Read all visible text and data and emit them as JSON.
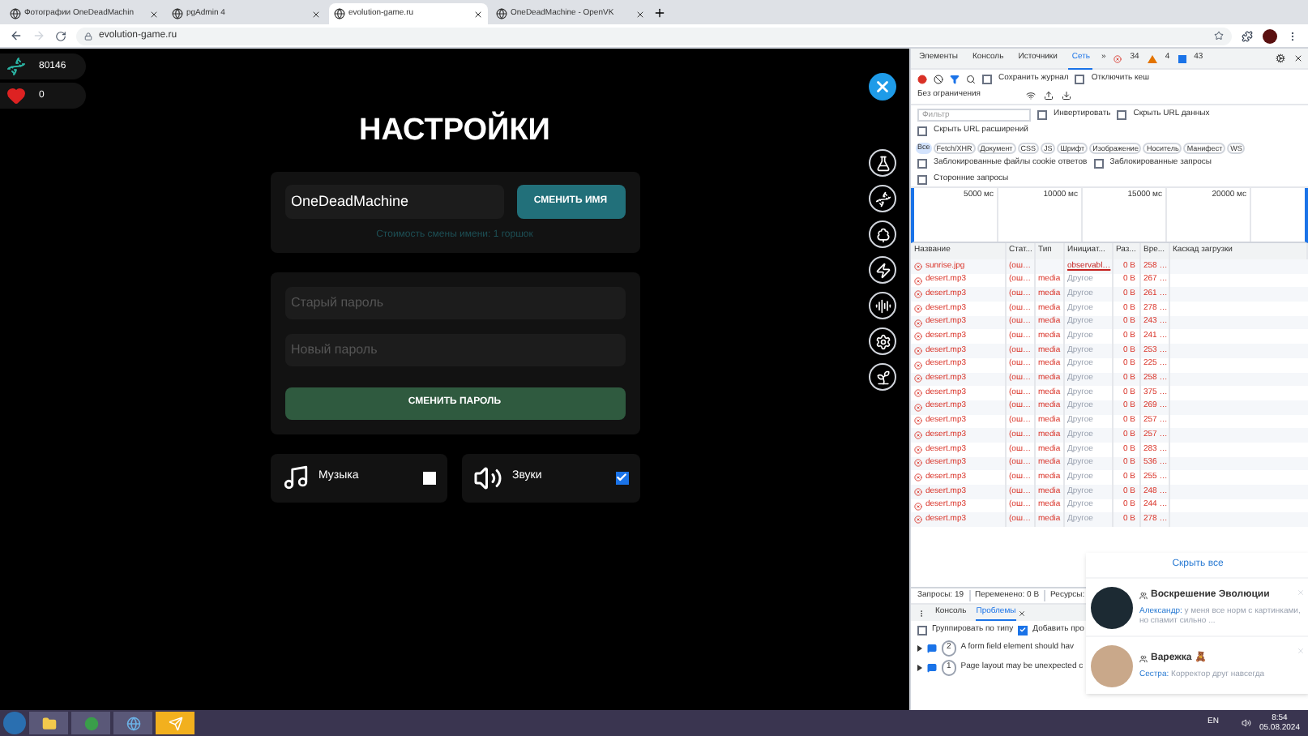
{
  "browser": {
    "tabs": [
      {
        "title": "Фотографии OneDeadMachin",
        "selected": false
      },
      {
        "title": "pgAdmin 4",
        "selected": false
      },
      {
        "title": "evolution-game.ru",
        "selected": true
      },
      {
        "title": "OneDeadMachine - OpenVK",
        "selected": false
      }
    ],
    "address": "evolution-game.ru"
  },
  "game": {
    "counters": [
      {
        "kind": "dna",
        "value": "80146"
      },
      {
        "kind": "heart",
        "value": "0"
      }
    ],
    "title": "НАСТРОЙКИ",
    "name_field": {
      "value": "OneDeadMachine"
    },
    "name_button": "СМЕНИТЬ ИМЯ",
    "name_cost": "Стоимость смены имени: 1 горшок",
    "old_password": {
      "placeholder": "Старый пароль"
    },
    "new_password": {
      "placeholder": "Новый пароль"
    },
    "password_button": "СМЕНИТЬ ПАРОЛЬ",
    "toggles": [
      {
        "kind": "music",
        "label": "Музыка",
        "checked": false
      },
      {
        "kind": "sound",
        "label": "Звуки",
        "checked": true
      }
    ]
  },
  "devtools": {
    "tabs": [
      {
        "label": "Элементы",
        "selected": false
      },
      {
        "label": "Консоль",
        "selected": false
      },
      {
        "label": "Источники",
        "selected": false
      },
      {
        "label": "Сеть",
        "selected": true
      }
    ],
    "more": "»",
    "errors": "34",
    "warnings": "4",
    "infos": "43",
    "preserve_log": {
      "label": "Сохранить журнал",
      "checked": false
    },
    "disable_cache": {
      "label": "Отключить кеш",
      "checked": false
    },
    "throttling": "Без ограничения",
    "filter": {
      "placeholder": "Фильтр"
    },
    "filter_options": [
      {
        "label": "Инвертировать",
        "checked": false
      },
      {
        "label": "Скрыть URL данных",
        "checked": false
      },
      {
        "label": "Скрыть URL расширений",
        "checked": false
      }
    ],
    "types": [
      {
        "label": "Все",
        "selected": true
      },
      {
        "label": "Fetch/XHR",
        "selected": false
      },
      {
        "label": "Документ",
        "selected": false
      },
      {
        "label": "CSS",
        "selected": false
      },
      {
        "label": "JS",
        "selected": false
      },
      {
        "label": "Шрифт",
        "selected": false
      },
      {
        "label": "Изображение",
        "selected": false
      },
      {
        "label": "Носитель",
        "selected": false
      },
      {
        "label": "Манифест",
        "selected": false
      },
      {
        "label": "WS",
        "selected": false
      }
    ],
    "blocked_options": [
      {
        "label": "Заблокированные файлы cookie ответов",
        "checked": false
      },
      {
        "label": "Заблокированные запросы",
        "checked": false
      },
      {
        "label": "Сторонние запросы",
        "checked": false
      }
    ],
    "timeline_ticks": [
      "5000 мс",
      "10000 мс",
      "15000 мс",
      "20000 мс"
    ],
    "columns": [
      "Название",
      "Стат...",
      "Тип",
      "Инициат...",
      "Раз...",
      "Вре...",
      "Каскад загрузки"
    ],
    "rows": [
      [
        "sunrise.jpg",
        "(ош…",
        "",
        "observabl…",
        "0 B",
        "258 …"
      ],
      [
        "desert.mp3",
        "(ош…",
        "media",
        "Другое",
        "0 B",
        "267 …"
      ],
      [
        "desert.mp3",
        "(ош…",
        "media",
        "Другое",
        "0 B",
        "261 …"
      ],
      [
        "desert.mp3",
        "(ош…",
        "media",
        "Другое",
        "0 B",
        "278 …"
      ],
      [
        "desert.mp3",
        "(ош…",
        "media",
        "Другое",
        "0 B",
        "243 …"
      ],
      [
        "desert.mp3",
        "(ош…",
        "media",
        "Другое",
        "0 B",
        "241 …"
      ],
      [
        "desert.mp3",
        "(ош…",
        "media",
        "Другое",
        "0 B",
        "253 …"
      ],
      [
        "desert.mp3",
        "(ош…",
        "media",
        "Другое",
        "0 B",
        "225 …"
      ],
      [
        "desert.mp3",
        "(ош…",
        "media",
        "Другое",
        "0 B",
        "258 …"
      ],
      [
        "desert.mp3",
        "(ош…",
        "media",
        "Другое",
        "0 B",
        "375 …"
      ],
      [
        "desert.mp3",
        "(ош…",
        "media",
        "Другое",
        "0 B",
        "269 …"
      ],
      [
        "desert.mp3",
        "(ош…",
        "media",
        "Другое",
        "0 B",
        "257 …"
      ],
      [
        "desert.mp3",
        "(ош…",
        "media",
        "Другое",
        "0 B",
        "257 …"
      ],
      [
        "desert.mp3",
        "(ош…",
        "media",
        "Другое",
        "0 B",
        "283 …"
      ],
      [
        "desert.mp3",
        "(ош…",
        "media",
        "Другое",
        "0 B",
        "536 …"
      ],
      [
        "desert.mp3",
        "(ош…",
        "media",
        "Другое",
        "0 B",
        "255 …"
      ],
      [
        "desert.mp3",
        "(ош…",
        "media",
        "Другое",
        "0 B",
        "248 …"
      ],
      [
        "desert.mp3",
        "(ош…",
        "media",
        "Другое",
        "0 B",
        "244 …"
      ],
      [
        "desert.mp3",
        "(ош…",
        "media",
        "Другое",
        "0 B",
        "278 …"
      ]
    ],
    "status": [
      "Запросы: 19",
      "Переменено: 0 B",
      "Ресурсы:"
    ],
    "drawer_tabs": [
      {
        "label": "Консоль",
        "selected": false
      },
      {
        "label": "Проблемы",
        "selected": true
      }
    ],
    "drawer_options": [
      {
        "label": "Группировать по типу",
        "checked": false
      },
      {
        "label": "Добавить про",
        "checked": true
      }
    ],
    "issues": [
      {
        "count": "2",
        "text": "A form field element should hav"
      },
      {
        "count": "1",
        "text": "Page layout may be unexpected c"
      }
    ]
  },
  "notifications": {
    "hide_all": "Скрыть все",
    "items": [
      {
        "title": "Воскрешение Эволюции",
        "sender": "Александр:",
        "text": "у меня все норм с картинками, но спамит сильно ..."
      },
      {
        "title": "Варежка 🧸",
        "sender": "Сестра:",
        "text": "Корректор друг навсегда"
      }
    ]
  },
  "taskbar": {
    "language": "EN",
    "time": "8:54",
    "date": "05.08.2024"
  }
}
